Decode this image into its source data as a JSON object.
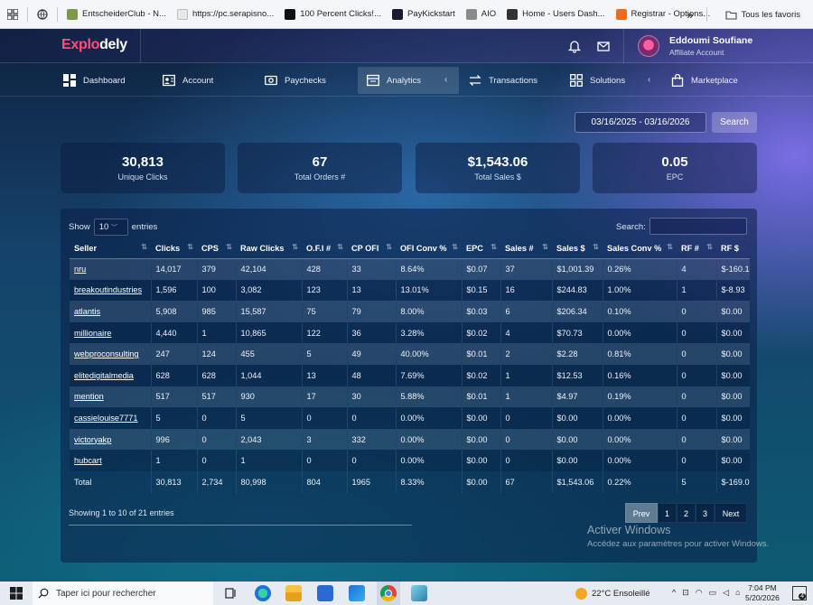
{
  "bookmarks": [
    {
      "label": "EntscheiderClub - N...",
      "color": "#7a9a4a"
    },
    {
      "label": "https://pc.serapisno...",
      "color": "#e8e8e8"
    },
    {
      "label": "100 Percent Clicks!...",
      "color": "#111111"
    },
    {
      "label": "PayKickstart",
      "color": "#1a1a2e"
    },
    {
      "label": "AIO",
      "color": "#8a8a8a"
    },
    {
      "label": "Home - Users Dash...",
      "color": "#333333"
    },
    {
      "label": "Registrar - Options...",
      "color": "#f26b1d"
    }
  ],
  "bookmarks_more": "»",
  "bookmarks_all": "Tous les favoris",
  "app": {
    "logo_a": "Explo",
    "logo_b": "dely",
    "user_name": "Eddoumi Soufiane",
    "user_role": "Affiliate Account"
  },
  "nav": [
    {
      "label": "Dashboard",
      "icon": "dashboard-icon"
    },
    {
      "label": "Account",
      "icon": "account-icon"
    },
    {
      "label": "Paychecks",
      "icon": "paychecks-icon"
    },
    {
      "label": "Analytics",
      "icon": "analytics-icon"
    },
    {
      "label": "Transactions",
      "icon": "transactions-icon"
    },
    {
      "label": "Solutions",
      "icon": "solutions-icon"
    },
    {
      "label": "Marketplace",
      "icon": "marketplace-icon"
    }
  ],
  "date_range": "03/16/2025 - 03/16/2026",
  "search_button": "Search",
  "stats": [
    {
      "value": "30,813",
      "label": "Unique Clicks"
    },
    {
      "value": "67",
      "label": "Total Orders #"
    },
    {
      "value": "$1,543.06",
      "label": "Total Sales $"
    },
    {
      "value": "0.05",
      "label": "EPC"
    }
  ],
  "table": {
    "show_label": "Show",
    "entries_label": "entries",
    "page_length": "10",
    "search_label": "Search:",
    "headers": [
      "Seller",
      "Clicks",
      "CPS",
      "Raw Clicks",
      "O.F.I #",
      "CP OFI",
      "OFI Conv %",
      "EPC",
      "Sales #",
      "Sales $",
      "Sales Conv %",
      "RF #",
      "RF $"
    ],
    "rows": [
      [
        "nru",
        "14,017",
        "379",
        "42,104",
        "428",
        "33",
        "8.64%",
        "$0.07",
        "37",
        "$1,001.39",
        "0.26%",
        "4",
        "$-160.1"
      ],
      [
        "breakoutindustries",
        "1,596",
        "100",
        "3,082",
        "123",
        "13",
        "13.01%",
        "$0.15",
        "16",
        "$244.83",
        "1.00%",
        "1",
        "$-8.93"
      ],
      [
        "atlantis",
        "5,908",
        "985",
        "15,587",
        "75",
        "79",
        "8.00%",
        "$0.03",
        "6",
        "$206.34",
        "0.10%",
        "0",
        "$0.00"
      ],
      [
        "millionaire",
        "4,440",
        "1",
        "10,865",
        "122",
        "36",
        "3.28%",
        "$0.02",
        "4",
        "$70.73",
        "0.00%",
        "0",
        "$0.00"
      ],
      [
        "webproconsulting",
        "247",
        "124",
        "455",
        "5",
        "49",
        "40.00%",
        "$0.01",
        "2",
        "$2.28",
        "0.81%",
        "0",
        "$0.00"
      ],
      [
        "elitedigitalmedia",
        "628",
        "628",
        "1,044",
        "13",
        "48",
        "7.69%",
        "$0.02",
        "1",
        "$12.53",
        "0.16%",
        "0",
        "$0.00"
      ],
      [
        "mention",
        "517",
        "517",
        "930",
        "17",
        "30",
        "5.88%",
        "$0.01",
        "1",
        "$4.97",
        "0.19%",
        "0",
        "$0.00"
      ],
      [
        "cassielouise7771",
        "5",
        "0",
        "5",
        "0",
        "0",
        "0.00%",
        "$0.00",
        "0",
        "$0.00",
        "0.00%",
        "0",
        "$0.00"
      ],
      [
        "victoryakp",
        "996",
        "0",
        "2,043",
        "3",
        "332",
        "0.00%",
        "$0.00",
        "0",
        "$0.00",
        "0.00%",
        "0",
        "$0.00"
      ],
      [
        "hubcart",
        "1",
        "0",
        "1",
        "0",
        "0",
        "0.00%",
        "$0.00",
        "0",
        "$0.00",
        "0.00%",
        "0",
        "$0.00"
      ]
    ],
    "total": [
      "Total",
      "30,813",
      "2,734",
      "80,998",
      "804",
      "1965",
      "8.33%",
      "$0.00",
      "67",
      "$1,543.06",
      "0.22%",
      "5",
      "$-169.0"
    ],
    "info": "Showing 1 to 10 of 21 entries",
    "pager": {
      "prev": "Prev",
      "pages": [
        "1",
        "2",
        "3"
      ],
      "next": "Next"
    }
  },
  "watermark": {
    "line1": "Activer Windows",
    "line2": "Accédez aux paramètres pour activer Windows."
  },
  "taskbar": {
    "search_placeholder": "Taper ici pour rechercher",
    "weather": "22°C  Ensoleillé",
    "time": "7:04 PM",
    "date": "5/20/2026",
    "notif_count": "4"
  }
}
